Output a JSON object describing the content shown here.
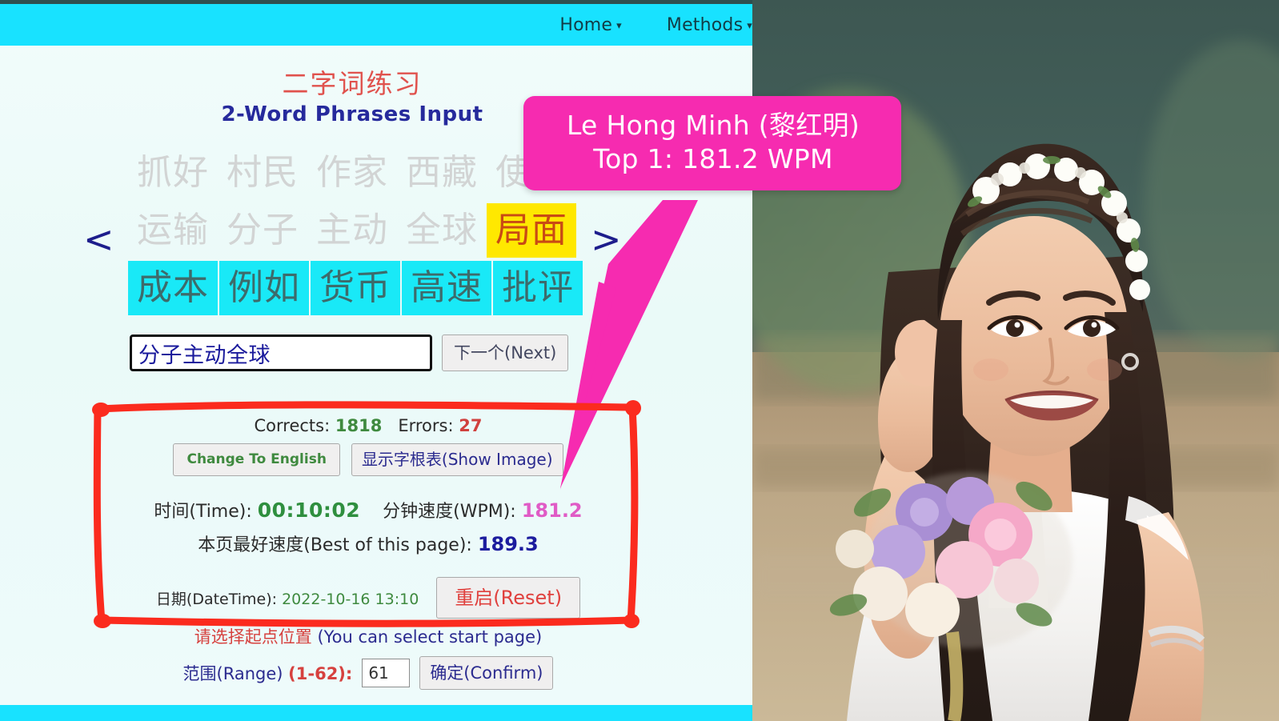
{
  "nav": {
    "items": [
      {
        "label": "Home",
        "caret": "▾",
        "icon": "chevron-down-icon"
      },
      {
        "label": "Methods",
        "caret": "▾",
        "icon": "chevron-down-icon"
      }
    ]
  },
  "header": {
    "title_cn": "二字词练习",
    "title_en": "2-Word Phrases Input"
  },
  "grid": {
    "prev_arrow": "<",
    "next_arrow": ">",
    "rows": [
      {
        "state": "done",
        "cells": [
          "抓好",
          "村民",
          "作家",
          "西藏",
          "使用"
        ]
      },
      {
        "state": "current",
        "cells": [
          "运输",
          "分子",
          "主动",
          "全球",
          "局面"
        ],
        "active_index": 4
      },
      {
        "state": "next",
        "cells": [
          "成本",
          "例如",
          "货币",
          "高速",
          "批评"
        ]
      }
    ]
  },
  "input": {
    "value": "分子主动全球",
    "placeholder": "",
    "next_button": "下一个(Next)"
  },
  "stats": {
    "corrects_label": "Corrects:",
    "corrects_value": "1818",
    "errors_label": "Errors:",
    "errors_value": "27",
    "change_lang_button": "Change To English",
    "show_image_button": "显示字根表(Show Image)",
    "time_label": "时间(Time):",
    "time_value": "00:10:02",
    "wpm_label": "分钟速度(WPM):",
    "wpm_value": "181.2",
    "best_label": "本页最好速度(Best of this page):",
    "best_value": "189.3",
    "datetime_label": "日期(DateTime):",
    "datetime_value": "2022-10-16 13:10",
    "reset_button": "重启(Reset)"
  },
  "range": {
    "hint_cn": "请选择起点位置",
    "hint_en": "(You can select start page)",
    "label": "范围(Range)",
    "bounds": "(1-62):",
    "value": "61",
    "confirm_button": "确定(Confirm)"
  },
  "callout": {
    "line1": "Le Hong Minh (黎红明)",
    "line2": "Top 1:  181.2 WPM"
  },
  "colors": {
    "nav_bar": "#18e2ff",
    "callout_bg": "#f62bb0",
    "highlight_yellow": "#ffe800",
    "next_row_cyan": "#19e9f7",
    "annotation_red": "#fb2b1e",
    "arrow_pink": "#f62bb0",
    "title_red": "#e0524d",
    "title_navy": "#262a9c"
  }
}
